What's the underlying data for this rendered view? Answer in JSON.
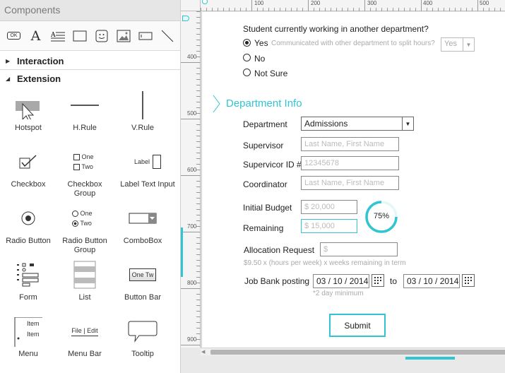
{
  "panel": {
    "title": "Components",
    "sections": [
      "Interaction",
      "Extension"
    ]
  },
  "components": [
    {
      "label": "Hotspot"
    },
    {
      "label": "H.Rule"
    },
    {
      "label": "V.Rule"
    },
    {
      "label": "Checkbox"
    },
    {
      "label": "Checkbox Group"
    },
    {
      "label": "Label Text Input"
    },
    {
      "label": "Radio Button"
    },
    {
      "label": "Radio Button Group"
    },
    {
      "label": "ComboBox"
    },
    {
      "label": "Form"
    },
    {
      "label": "List"
    },
    {
      "label": "Button Bar"
    },
    {
      "label": "Menu"
    },
    {
      "label": "Menu Bar"
    },
    {
      "label": "Tooltip"
    }
  ],
  "icon_text": {
    "ok": "OK",
    "text_a": "A",
    "one": "One",
    "two": "Two",
    "label": "Label",
    "one_two": "One Tw",
    "item": "Item",
    "file_edit": "File | Edit"
  },
  "ruler": {
    "top": [
      "100",
      "200",
      "300",
      "400",
      "500"
    ],
    "left": [
      "400",
      "500",
      "600",
      "700",
      "800",
      "900"
    ]
  },
  "form": {
    "question": "Student currently working in another department?",
    "radio_yes": "Yes",
    "radio_yes_hint": "Communicated with other department to split hours?",
    "yes_select": "Yes",
    "radio_no": "No",
    "radio_not_sure": "Not Sure",
    "section_title": "Department Info",
    "department_label": "Department",
    "department_value": "Admissions",
    "supervisor_label": "Supervisor",
    "supervisor_placeholder": "Last Name, First Name",
    "supervisor_id_label": "Supervicor ID #",
    "supervisor_id_placeholder": "12345678",
    "coordinator_label": "Coordinator",
    "coordinator_placeholder": "Last Name, First Name",
    "initial_budget_label": "Initial Budget",
    "initial_budget_placeholder": "$ 20,000",
    "remaining_label": "Remaining",
    "remaining_placeholder": "$ 15,000",
    "budget_percent": 0.75,
    "budget_percent_label": "75%",
    "allocation_label": "Allocation Request",
    "allocation_placeholder": "$",
    "allocation_hint": "$9.50 x (hours per week) x weeks remaining in term",
    "job_bank_label": "Job Bank posting",
    "date_from": "03 / 10 / 2014",
    "to_label": "to",
    "date_to": "03 / 10 / 2014",
    "date_hint": "*2 day minimum",
    "submit_label": "Submit"
  },
  "colors": {
    "accent": "#31c5d1",
    "panel_bg": "#ffffff"
  }
}
